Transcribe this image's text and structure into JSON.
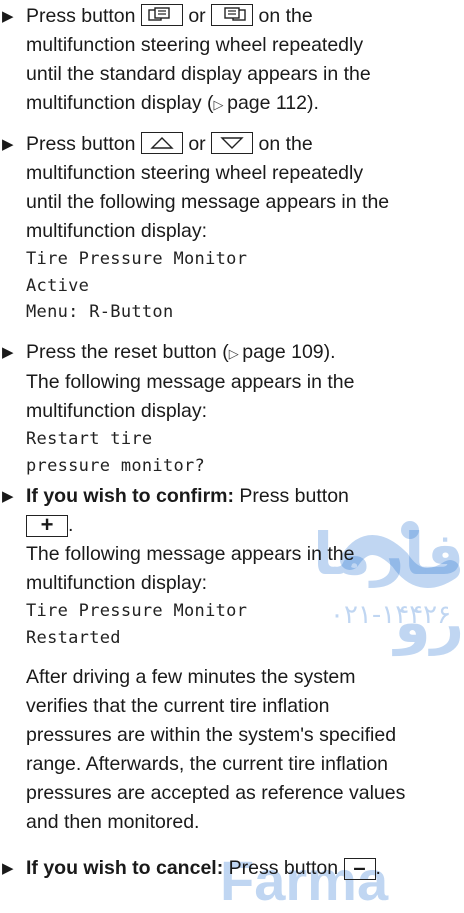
{
  "step1": {
    "text_press": "Press button",
    "text_or": "or",
    "text_rest1": "on the",
    "text_line2": "multifunction steering wheel repeatedly",
    "text_line3": "until the standard display appears in the",
    "text_line4_pre": "multifunction display (",
    "page_ref": "page 112",
    "text_line4_post": ")."
  },
  "step2": {
    "text_press": "Press button",
    "text_or": "or",
    "text_rest1": "on the",
    "text_line2": "multifunction steering wheel repeatedly",
    "text_line3": "until the following message appears in the",
    "text_line4": "multifunction display:",
    "msg_line1": "Tire Pressure Monitor",
    "msg_line2": "Active",
    "msg_line3": "Menu: R-Button"
  },
  "step3": {
    "text_pre": "Press the reset button (",
    "page_ref": "page 109",
    "text_post": ").",
    "text_line2": "The following message appears in the",
    "text_line3": "multifunction display:",
    "msg_line1": "Restart tire",
    "msg_line2": "pressure monitor?"
  },
  "step4": {
    "bold": "If you wish to confirm:",
    "text": "Press button",
    "button_symbol": "+",
    "text_line2": "The following message appears in the",
    "text_line3": "multifunction display:",
    "msg_line1": "Tire Pressure Monitor",
    "msg_line2": "Restarted",
    "para_line1": "After driving a few minutes the system",
    "para_line2": "verifies that the current tire inflation",
    "para_line3": "pressures are within the system's specified",
    "para_line4": "range. Afterwards, the current tire inflation",
    "para_line5": "pressures are accepted as reference values",
    "para_line6": "and then monitored."
  },
  "step5": {
    "bold": "If you wish to cancel:",
    "text": "Press button",
    "button_symbol": "–"
  },
  "icons": {
    "bullet": "arrow-right-triangle",
    "crossref": "page-reference-triangle"
  },
  "watermark": {
    "arabic": "فارما رو",
    "digits": "۰۲۱-۱۴۴۲۶",
    "brand": "Farma"
  }
}
